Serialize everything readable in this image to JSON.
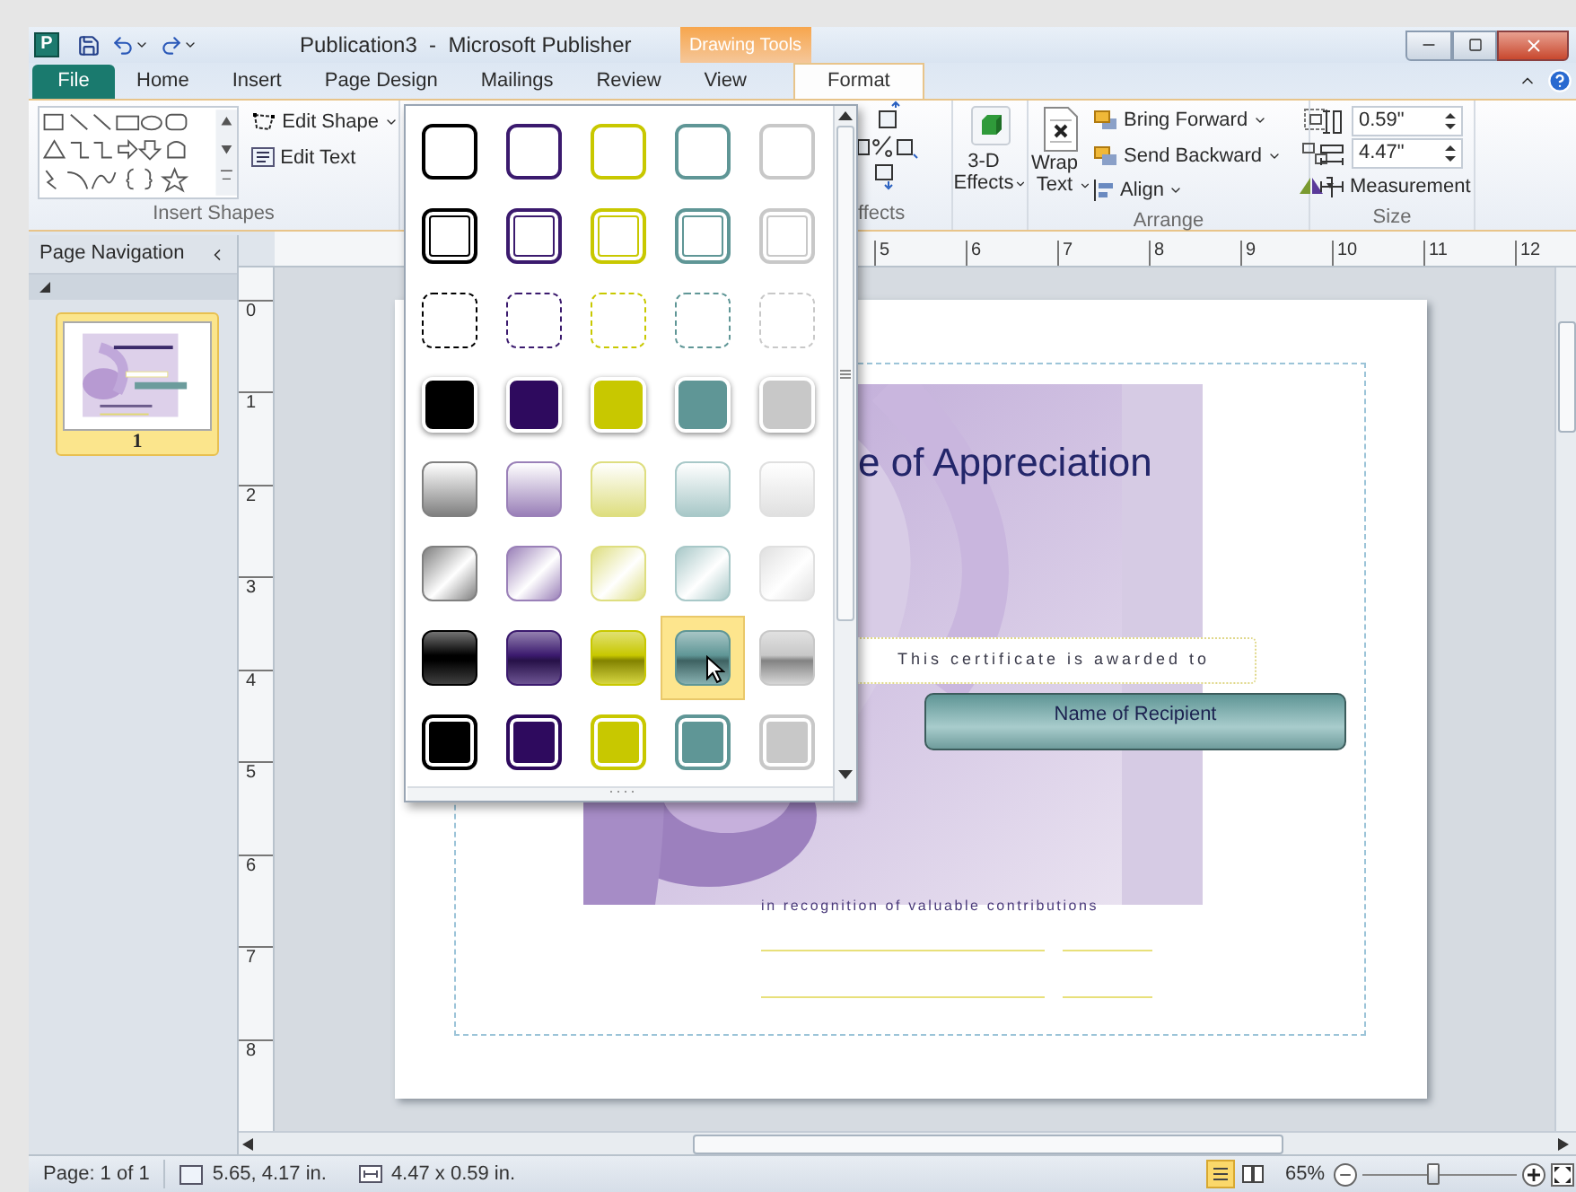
{
  "window": {
    "app_icon": "P",
    "title": "Publication3  -  Microsoft Publisher",
    "contextual_tab": "Drawing Tools"
  },
  "tabs": [
    {
      "label": "File",
      "selected": false,
      "kind": "file"
    },
    {
      "label": "Home",
      "selected": false,
      "kind": "tab"
    },
    {
      "label": "Insert",
      "selected": false,
      "kind": "tab"
    },
    {
      "label": "Page Design",
      "selected": false,
      "kind": "tab"
    },
    {
      "label": "Mailings",
      "selected": false,
      "kind": "tab"
    },
    {
      "label": "Review",
      "selected": false,
      "kind": "tab"
    },
    {
      "label": "View",
      "selected": false,
      "kind": "tab"
    },
    {
      "label": "Format",
      "selected": true,
      "kind": "tab"
    }
  ],
  "ribbon": {
    "insert_shapes": {
      "edit_shape": "Edit Shape",
      "edit_text": "Edit Text",
      "label": "Insert Shapes"
    },
    "effects_label": "ffects",
    "three_d": "3-D\nEffects",
    "arrange": {
      "wrap_text": "Wrap\nText",
      "bring_forward": "Bring Forward",
      "send_backward": "Send Backward",
      "align": "Align",
      "label": "Arrange"
    },
    "size": {
      "height": "0.59\"",
      "width": "4.47\"",
      "measurement": "Measurement",
      "label": "Size"
    }
  },
  "style_gallery": {
    "rows": [
      {
        "kind": "outline",
        "swatches": [
          {
            "color": "#000000",
            "selected": false
          },
          {
            "color": "#3b1a6e",
            "selected": false
          },
          {
            "color": "#c8c800",
            "selected": false
          },
          {
            "color": "#5f9696",
            "selected": false
          },
          {
            "color": "#c8c8c8",
            "selected": false
          }
        ]
      },
      {
        "kind": "double",
        "swatches": [
          {
            "color": "#000000",
            "selected": false
          },
          {
            "color": "#3b1a6e",
            "selected": false
          },
          {
            "color": "#c8c800",
            "selected": false
          },
          {
            "color": "#5f9696",
            "selected": false
          },
          {
            "color": "#c8c8c8",
            "selected": false
          }
        ]
      },
      {
        "kind": "dashed",
        "swatches": [
          {
            "color": "#000000",
            "selected": false
          },
          {
            "color": "#3b1a6e",
            "selected": false
          },
          {
            "color": "#c8c800",
            "selected": false
          },
          {
            "color": "#5f9696",
            "selected": false
          },
          {
            "color": "#c8c8c8",
            "selected": false
          }
        ]
      },
      {
        "kind": "filled",
        "swatches": [
          {
            "color": "#000000",
            "selected": false
          },
          {
            "color": "#2e0a5e",
            "selected": false
          },
          {
            "color": "#c8c800",
            "selected": false
          },
          {
            "color": "#5f9696",
            "selected": false
          },
          {
            "color": "#c8c8c8",
            "selected": false
          }
        ]
      },
      {
        "kind": "gradient",
        "swatches": [
          {
            "color": "#808080",
            "selected": false
          },
          {
            "color": "#9a80b8",
            "selected": false
          },
          {
            "color": "#dede80",
            "selected": false
          },
          {
            "color": "#a8c8c8",
            "selected": false
          },
          {
            "color": "#e0e0e0",
            "selected": false
          }
        ]
      },
      {
        "kind": "diagonal",
        "swatches": [
          {
            "color": "#808080",
            "selected": false
          },
          {
            "color": "#9a80b8",
            "selected": false
          },
          {
            "color": "#dede80",
            "selected": false
          },
          {
            "color": "#a8c8c8",
            "selected": false
          },
          {
            "color": "#e0e0e0",
            "selected": false
          }
        ]
      },
      {
        "kind": "glossy",
        "swatches": [
          {
            "color": "#000000",
            "selected": false
          },
          {
            "color": "#3b1a6e",
            "selected": false
          },
          {
            "color": "#c8c800",
            "selected": false
          },
          {
            "color": "#5f9696",
            "selected": true
          },
          {
            "color": "#c8c8c8",
            "selected": false
          }
        ]
      },
      {
        "kind": "framed",
        "swatches": [
          {
            "color": "#000000",
            "selected": false
          },
          {
            "color": "#2e0a5e",
            "selected": false
          },
          {
            "color": "#c8c800",
            "selected": false
          },
          {
            "color": "#5f9696",
            "selected": false
          },
          {
            "color": "#c8c8c8",
            "selected": false
          }
        ]
      }
    ]
  },
  "page_navigation": {
    "title": "Page Navigation",
    "pages": [
      {
        "label": "1",
        "selected": true
      }
    ]
  },
  "horizontal_ruler": [
    "5",
    "6",
    "7",
    "8",
    "9",
    "10",
    "11",
    "12"
  ],
  "vertical_ruler": [
    "0",
    "1",
    "2",
    "3",
    "4",
    "5",
    "6",
    "7",
    "8"
  ],
  "certificate": {
    "title": "e of Appreciation",
    "awarded": "This certificate is awarded to",
    "recipient": "Name of Recipient",
    "recognition": "in recognition of valuable contributions"
  },
  "status_bar": {
    "page": "Page: 1 of 1",
    "position": "5.65, 4.17 in.",
    "size": "4.47 x 0.59 in.",
    "zoom": "65%",
    "zoom_slider": {
      "level": 0.45
    }
  }
}
